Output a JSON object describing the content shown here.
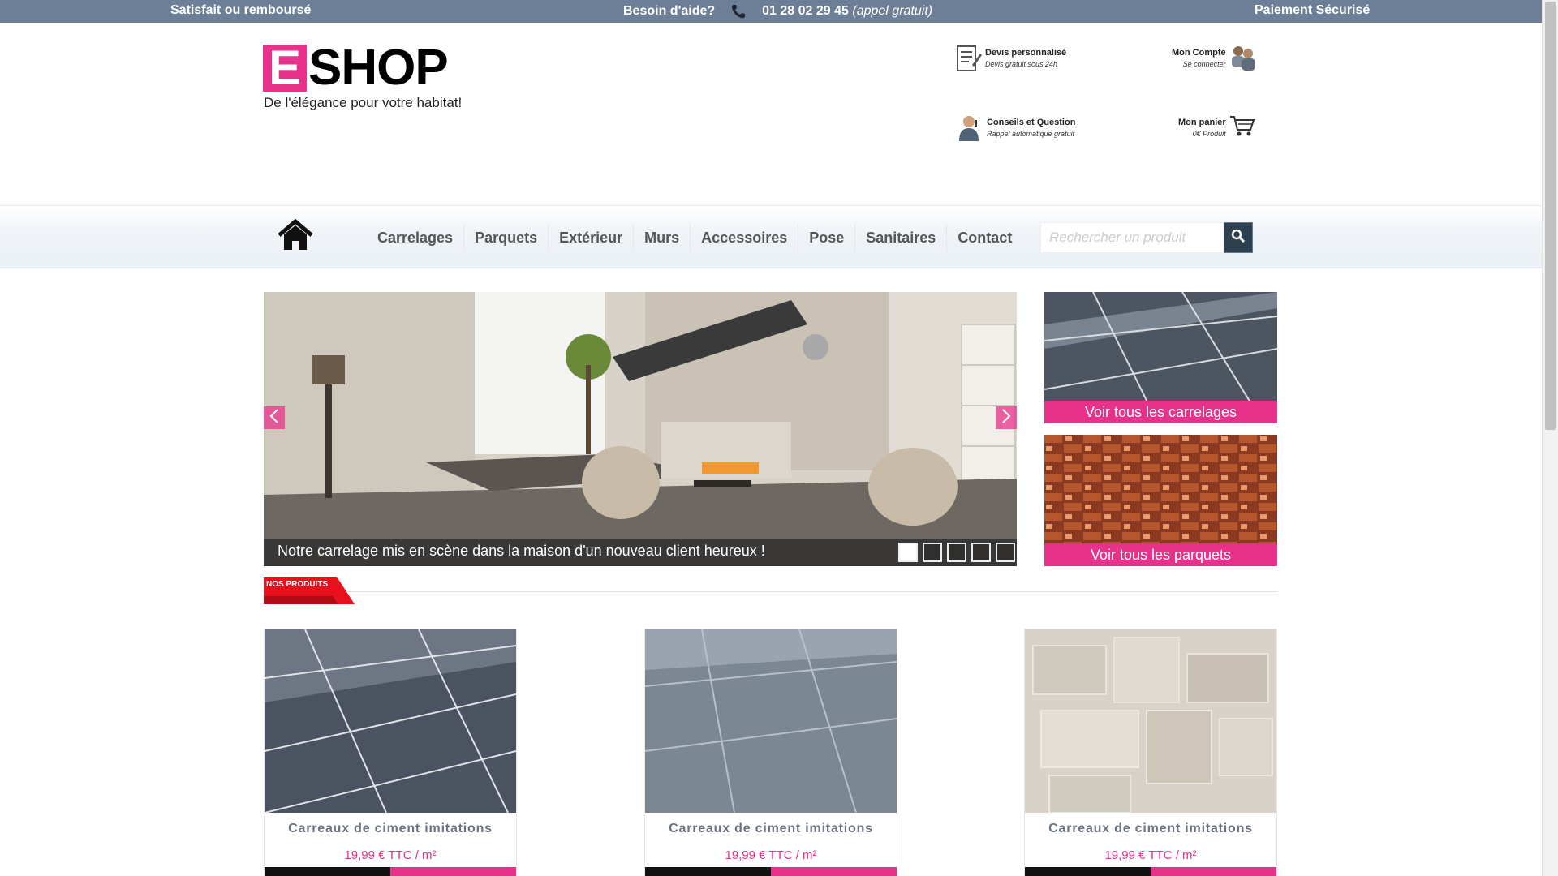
{
  "topbar": {
    "left": "Satisfait ou remboursé",
    "help": "Besoin d'aide?",
    "phone": "01 28 02 29 45",
    "phone_note": "(appel gratuit)",
    "right": "Paiement Sécurisé"
  },
  "logo": {
    "letter": "E",
    "rest": "SHOP",
    "tagline": "De l'élégance pour votre habitat!"
  },
  "header": {
    "quote": {
      "title": "Devis personnalisé",
      "subtitle": "Devis gratuit sous 24h",
      "icon": "quote-form-icon"
    },
    "account": {
      "title": "Mon Compte",
      "subtitle": "Se connecter",
      "icon": "users-icon"
    },
    "advice": {
      "title": "Conseils et Question",
      "subtitle": "Rappel automatique gratuit",
      "icon": "advisor-icon"
    },
    "cart": {
      "title": "Mon panier",
      "subtitle": "0€ Produit",
      "icon": "cart-icon"
    }
  },
  "nav": {
    "home_icon": "home-icon",
    "items": [
      "Carrelages",
      "Parquets",
      "Extérieur",
      "Murs",
      "Accessoires",
      "Pose",
      "Sanitaires",
      "Contact"
    ],
    "search_placeholder": "Rechercher un produit",
    "search_icon": "search-icon"
  },
  "slider": {
    "caption": "Notre carrelage mis en scène dans la maison d'un nouveau client heureux !",
    "slide_count": 5,
    "active_slide": 1
  },
  "promos": [
    {
      "label": "Voir tous les carrelages"
    },
    {
      "label": "Voir tous les parquets"
    }
  ],
  "section": {
    "title": "NOS PRODUITS"
  },
  "products": [
    {
      "name": "Carreaux de ciment imitations",
      "price": "19,99 € TTC / m²"
    },
    {
      "name": "Carreaux de ciment imitations",
      "price": "19,99 € TTC / m²"
    },
    {
      "name": "Carreaux de ciment imitations",
      "price": "19,99 € TTC / m²"
    }
  ],
  "colors": {
    "topbar": "#6d7f96",
    "accent": "#e8318a",
    "section_tag": "#e8101c",
    "search_button": "#2d4050"
  }
}
